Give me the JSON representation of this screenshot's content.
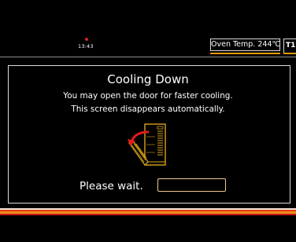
{
  "status": {
    "time": "13:43",
    "oven_temp": "Oven Temp. 244℃",
    "tray": "T1"
  },
  "dialog": {
    "title": "Cooling Down",
    "message_line1": "You may open the door for faster cooling.",
    "message_line2": "This screen disappears automatically.",
    "icon": "oven-door-open-icon",
    "wait_label": "Please wait.",
    "progress": 0
  },
  "colors": {
    "background": "#000000",
    "accent_orange": "#e39b00",
    "arrow_red": "#e21b1b",
    "oven_outline": "#d9a21a",
    "stripe_red": "#e83a1a",
    "stripe_orange": "#e8901a",
    "stripe_light": "#f0e6d8"
  }
}
